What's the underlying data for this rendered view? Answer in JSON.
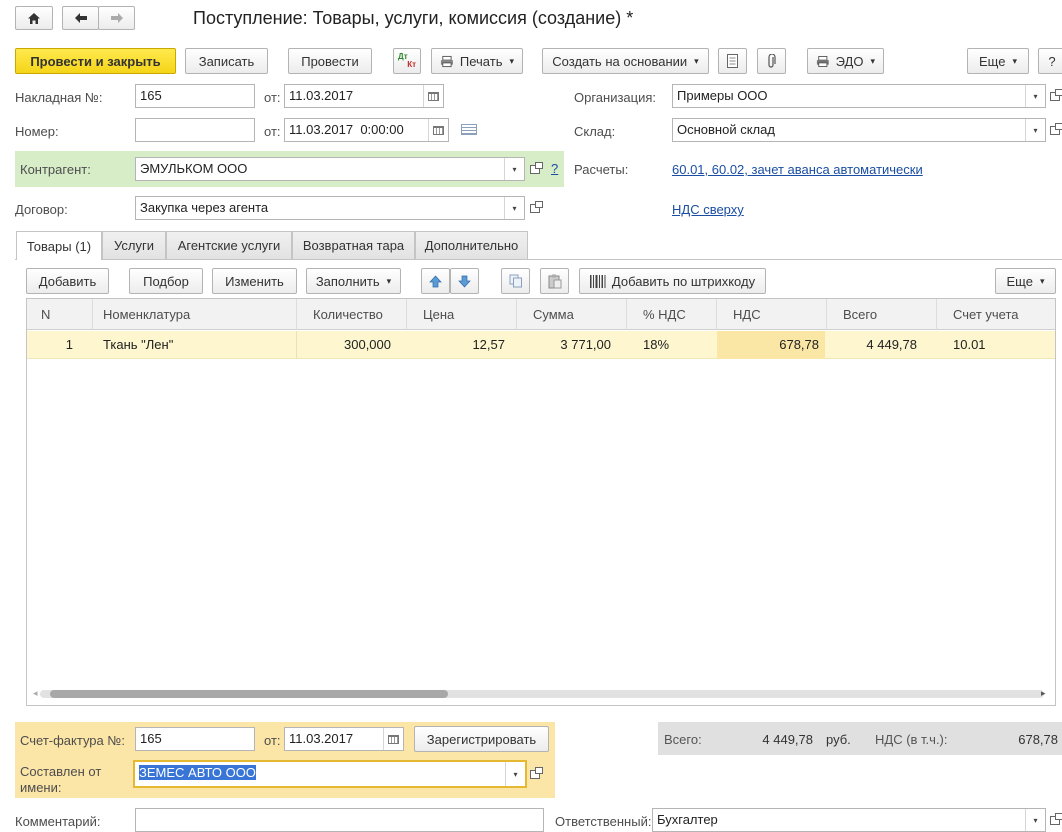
{
  "window": {
    "title": "Поступление: Товары, услуги, комиссия (создание) *",
    "help": "?"
  },
  "toolbar": {
    "post_close": "Провести и закрыть",
    "save": "Записать",
    "post": "Провести",
    "dtkt_top": "Дт",
    "dtkt_bottom": "Кт",
    "print": "Печать",
    "create_based": "Создать на основании",
    "edo": "ЭДО",
    "more": "Еще"
  },
  "form": {
    "invoice_label": "Накладная №:",
    "invoice_number": "165",
    "from_label": "от:",
    "invoice_date": "11.03.2017",
    "number_label": "Номер:",
    "number_value": "",
    "number_date": "11.03.2017  0:00:00",
    "org_label": "Организация:",
    "org_value": "Примеры ООО",
    "warehouse_label": "Склад:",
    "warehouse_value": "Основной склад",
    "counterparty_label": "Контрагент:",
    "counterparty_value": "ЭМУЛЬКОМ ООО",
    "counterparty_help": "?",
    "settlements_label": "Расчеты:",
    "settlements_link": "60.01, 60.02, зачет аванса автоматически",
    "contract_label": "Договор:",
    "contract_value": "Закупка через агента",
    "vat_link": "НДС сверху"
  },
  "tabs": [
    {
      "label": "Товары (1)",
      "active": true
    },
    {
      "label": "Услуги",
      "active": false
    },
    {
      "label": "Агентские услуги",
      "active": false
    },
    {
      "label": "Возвратная тара",
      "active": false
    },
    {
      "label": "Дополнительно",
      "active": false
    }
  ],
  "table_toolbar": {
    "add": "Добавить",
    "select": "Подбор",
    "edit": "Изменить",
    "fill": "Заполнить",
    "barcode": "Добавить по штрихкоду",
    "more": "Еще"
  },
  "table": {
    "columns": [
      "N",
      "Номенклатура",
      "Количество",
      "Цена",
      "Сумма",
      "% НДС",
      "НДС",
      "Всего",
      "Счет учета"
    ],
    "rows": [
      [
        "1",
        "Ткань \"Лен\"",
        "300,000",
        "12,57",
        "3 771,00",
        "18%",
        "678,78",
        "4 449,78",
        "10.01"
      ]
    ]
  },
  "footer": {
    "invoice_label": "Счет-фактура №:",
    "invoice_number": "165",
    "from_label": "от:",
    "invoice_date": "11.03.2017",
    "register": "Зарегистрировать",
    "issuer_label_1": "Составлен от",
    "issuer_label_2": "имени:",
    "issuer_value": "ЗЕМЕС АВТО ООО",
    "total_label": "Всего:",
    "total_value": "4 449,78",
    "currency": "руб.",
    "vat_label": "НДС (в т.ч.):",
    "vat_value": "678,78",
    "comment_label": "Комментарий:",
    "comment_value": "",
    "responsible_label": "Ответственный:",
    "responsible_value": "Бухгалтер"
  },
  "colors": {
    "primary_button": "#f5d519",
    "counterparty_bg": "#d7edc7",
    "invoice_panel_bg": "#fbe5a7",
    "selected_row": "#fdf6cf",
    "vat_cell": "#fbe7a5",
    "link": "#1a4ea2",
    "totals_panel": "#e0e0e0"
  },
  "icons": [
    "home-icon",
    "back-arrow-icon",
    "forward-arrow-icon",
    "printer-icon",
    "document-icon",
    "paperclip-icon",
    "edo-icon",
    "calendar-icon",
    "arrow-up-icon",
    "arrow-down-icon",
    "copy-icon",
    "paste-icon",
    "barcode-icon"
  ]
}
